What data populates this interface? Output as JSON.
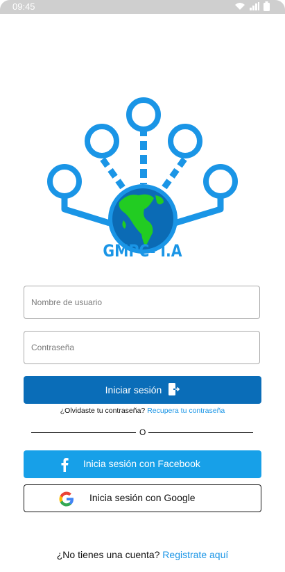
{
  "status_bar": {
    "time": "09:45",
    "icons": [
      "wifi-icon",
      "signal-icon",
      "battery-icon"
    ]
  },
  "logo": {
    "text": "GMPC- I.A",
    "colors": {
      "primary": "#1a95e6",
      "globe": "#0b6bb5",
      "land": "#22cc22"
    }
  },
  "form": {
    "username_placeholder": "Nombre de usuario",
    "password_placeholder": "Contraseña",
    "login_label": "Iniciar sesión",
    "forgot_prefix": "¿Olvidaste tu contraseña?",
    "forgot_link": "Recupera tu contraseña"
  },
  "divider_label": "O",
  "social": {
    "facebook_label": "Inicia sesión con Facebook",
    "google_label": "Inicia sesión con Google"
  },
  "register": {
    "prefix": "¿No tienes una cuenta?",
    "link": "Registrate aquí"
  },
  "colors": {
    "login_button": "#0a6db8",
    "facebook_button": "#17a0e8",
    "link": "#1a95e6"
  }
}
